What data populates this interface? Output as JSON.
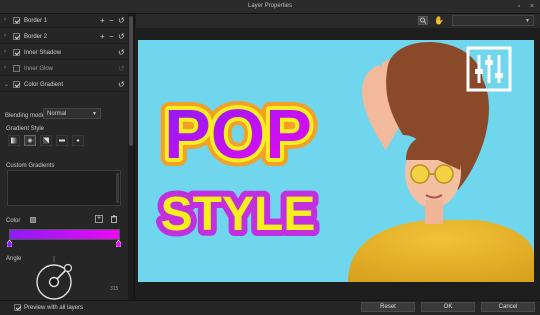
{
  "window": {
    "title": "Layer Properties"
  },
  "effects": [
    {
      "label": "Border 1",
      "checked": true
    },
    {
      "label": "Border 2",
      "checked": true
    },
    {
      "label": "Inner Shadow",
      "checked": true
    },
    {
      "label": "Inner Glow",
      "checked": false
    },
    {
      "label": "Color Gradient",
      "checked": true
    }
  ],
  "gradient": {
    "blend_mode_label": "Blending mode",
    "blend_mode_value": "Normal",
    "style_label": "Gradient Style",
    "custom_label": "Custom Gradients",
    "color_label": "Color",
    "angle_label": "Angle",
    "angle_value": "315",
    "start_color": "#8c1cf5",
    "end_color": "#ec09f2"
  },
  "artwork": {
    "line1": "POP",
    "line2": "STYLE"
  },
  "footer": {
    "preview_label": "Preview with all layers",
    "reset_label": "Reset",
    "ok_label": "OK",
    "cancel_label": "Cancel"
  }
}
